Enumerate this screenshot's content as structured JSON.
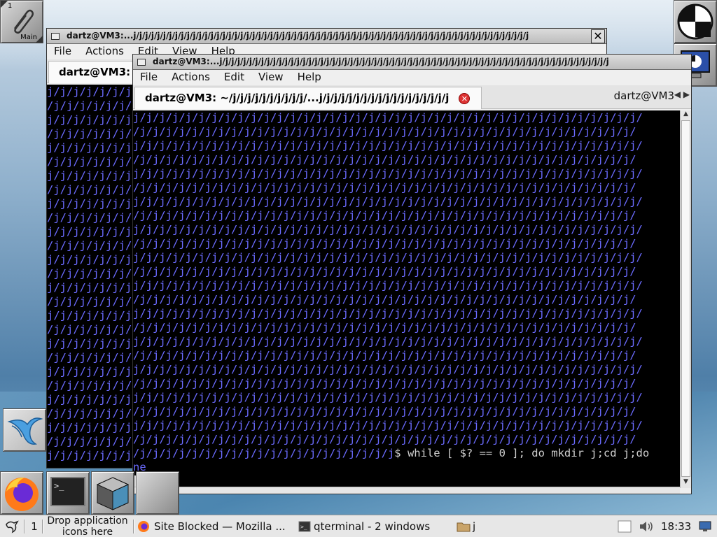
{
  "desktop": {
    "workspace_num": "1",
    "workspace_label": "Main"
  },
  "back_window": {
    "title": "dartz@VM3:...j/j/j/j/j/j/j/j/j/j/j/j/j/j/j/j/j/j/j/j/j/j/j/j/j/j/j/j/j/j/j/j/j/j/j/j/j/j/j/j/j/j/j/j/j/j/j/j/j/j/j/j/j/j/j/j/j/j/j/j/j/j/j/j/j/j/j",
    "close": "✕",
    "menu": [
      "File",
      "Actions",
      "Edit",
      "View",
      "Help"
    ],
    "tab_label": "dartz@VM3:",
    "terminal_text": "j/j/j/j/j/j/j/\n/j/j/j/j/j/j/\nj/j/j/j/j/j/j/\n/j/j/j/j/j/j/\nj/j/j/j/j/j/j/\n/j/j/j/j/j/j/\nj/j/j/j/j/j/j/\n/j/j/j/j/j/j/\nj/j/j/j/j/j/j/\n/j/j/j/j/j/j/\nj/j/j/j/j/j/j/\n/j/j/j/j/j/j/\nj/j/j/j/j/j/j/\n/j/j/j/j/j/j/\nj/j/j/j/j/j/j/\n/j/j/j/j/j/j/\nj/j/j/j/j/j/j/\n/j/j/j/j/j/j/\nj/j/j/j/j/j/j/\n/j/j/j/j/j/j/\nj/j/j/j/j/j/j/\n/j/j/j/j/j/j/\nj/j/j/j/j/j/j/\n/j/j/j/j/j/j/\nj/j/j/j/j/j/j/\n/j/j/j/j/j/j/\nj/j/j/j/j/j/j/"
  },
  "front_window": {
    "title": "dartz@VM3:...j/j/j/j/j/j/j/j/j/j/j/j/j/j/j/j/j/j/j/j/j/j/j/j/j/j/j/j/j/j/j/j/j/j/j/j/j/j/j/j/j/j/j/j/j/j/j/j/j/j/j/j/j/j/j/j/j/j/j/j/j/j/j/j/j/j",
    "menu": [
      "File",
      "Actions",
      "Edit",
      "View",
      "Help"
    ],
    "active_tab_label": "dartz@VM3: ~/j/j/j/j/j/j/j/j/j/j/...j/j/j/j/j/j/j/j/j/j/j/j/j/j/j/j/j/j",
    "second_tab_label": "dartz@VM3",
    "tab_arrows": "◀ ▶",
    "terminal_text": "j/j/j/j/j/j/j/j/j/j/j/j/j/j/j/j/j/j/j/j/j/j/j/j/j/j/j/j/j/j/j/j/j/j/j/j/j/j/j/\n/j/j/j/j/j/j/j/j/j/j/j/j/j/j/j/j/j/j/j/j/j/j/j/j/j/j/j/j/j/j/j/j/j/j/j/j/j/j/\nj/j/j/j/j/j/j/j/j/j/j/j/j/j/j/j/j/j/j/j/j/j/j/j/j/j/j/j/j/j/j/j/j/j/j/j/j/j/j/\n/j/j/j/j/j/j/j/j/j/j/j/j/j/j/j/j/j/j/j/j/j/j/j/j/j/j/j/j/j/j/j/j/j/j/j/j/j/j/\nj/j/j/j/j/j/j/j/j/j/j/j/j/j/j/j/j/j/j/j/j/j/j/j/j/j/j/j/j/j/j/j/j/j/j/j/j/j/j/\n/j/j/j/j/j/j/j/j/j/j/j/j/j/j/j/j/j/j/j/j/j/j/j/j/j/j/j/j/j/j/j/j/j/j/j/j/j/j/\nj/j/j/j/j/j/j/j/j/j/j/j/j/j/j/j/j/j/j/j/j/j/j/j/j/j/j/j/j/j/j/j/j/j/j/j/j/j/j/\n/j/j/j/j/j/j/j/j/j/j/j/j/j/j/j/j/j/j/j/j/j/j/j/j/j/j/j/j/j/j/j/j/j/j/j/j/j/j/\nj/j/j/j/j/j/j/j/j/j/j/j/j/j/j/j/j/j/j/j/j/j/j/j/j/j/j/j/j/j/j/j/j/j/j/j/j/j/j/\n/j/j/j/j/j/j/j/j/j/j/j/j/j/j/j/j/j/j/j/j/j/j/j/j/j/j/j/j/j/j/j/j/j/j/j/j/j/j/\nj/j/j/j/j/j/j/j/j/j/j/j/j/j/j/j/j/j/j/j/j/j/j/j/j/j/j/j/j/j/j/j/j/j/j/j/j/j/j/\n/j/j/j/j/j/j/j/j/j/j/j/j/j/j/j/j/j/j/j/j/j/j/j/j/j/j/j/j/j/j/j/j/j/j/j/j/j/j/\nj/j/j/j/j/j/j/j/j/j/j/j/j/j/j/j/j/j/j/j/j/j/j/j/j/j/j/j/j/j/j/j/j/j/j/j/j/j/j/\n/j/j/j/j/j/j/j/j/j/j/j/j/j/j/j/j/j/j/j/j/j/j/j/j/j/j/j/j/j/j/j/j/j/j/j/j/j/j/\nj/j/j/j/j/j/j/j/j/j/j/j/j/j/j/j/j/j/j/j/j/j/j/j/j/j/j/j/j/j/j/j/j/j/j/j/j/j/j/\n/j/j/j/j/j/j/j/j/j/j/j/j/j/j/j/j/j/j/j/j/j/j/j/j/j/j/j/j/j/j/j/j/j/j/j/j/j/j/\nj/j/j/j/j/j/j/j/j/j/j/j/j/j/j/j/j/j/j/j/j/j/j/j/j/j/j/j/j/j/j/j/j/j/j/j/j/j/j/\n/j/j/j/j/j/j/j/j/j/j/j/j/j/j/j/j/j/j/j/j/j/j/j/j/j/j/j/j/j/j/j/j/j/j/j/j/j/j/\nj/j/j/j/j/j/j/j/j/j/j/j/j/j/j/j/j/j/j/j/j/j/j/j/j/j/j/j/j/j/j/j/j/j/j/j/j/j/j/\n/j/j/j/j/j/j/j/j/j/j/j/j/j/j/j/j/j/j/j/j/j/j/j/j/j/j/j/j/j/j/j/j/j/j/j/j/j/j/\nj/j/j/j/j/j/j/j/j/j/j/j/j/j/j/j/j/j/j/j/j/j/j/j/j/j/j/j/j/j/j/j/j/j/j/j/j/j/j/\n/j/j/j/j/j/j/j/j/j/j/j/j/j/j/j/j/j/j/j/j/j/j/j/j/j/j/j/j/j/j/j/j/j/j/j/j/j/j/\nj/j/j/j/j/j/j/j/j/j/j/j/j/j/j/j/j/j/j/j/j/j/j/j/j/j/j/j/j/j/j/j/j/j/j/j/j/j/j/\n/j/j/j/j/j/j/j/j/j/j/j/j/j/j/j/j/j/j/j/j/j/j/j/j/j/j/j/j/j/j/j/j/j/j/j/j/j/j/",
    "prompt_path": "/j/j/j/j/j/j/j/j/j/j/j/j/j/j/j/j/j/j/j/j",
    "command": "$ while [ $? == 0 ]; do mkdir j;cd j;do",
    "command_wrap": "ne"
  },
  "taskbar": {
    "menu_icon": "start-menu-icon",
    "desktop_num": "1",
    "drop_text": "Drop application\nicons here",
    "tasks": [
      {
        "label": "Site Blocked — Mozilla ...",
        "icon": "firefox-icon"
      },
      {
        "label": "qterminal - 2 windows",
        "icon": "terminal-icon"
      },
      {
        "label": "j",
        "icon": "folder-icon"
      }
    ],
    "clock": "18:33"
  },
  "colors": {
    "terminal_text": "#6b6bff",
    "terminal_bg": "#000000",
    "taskbar_bg": "#e7e7e7"
  }
}
